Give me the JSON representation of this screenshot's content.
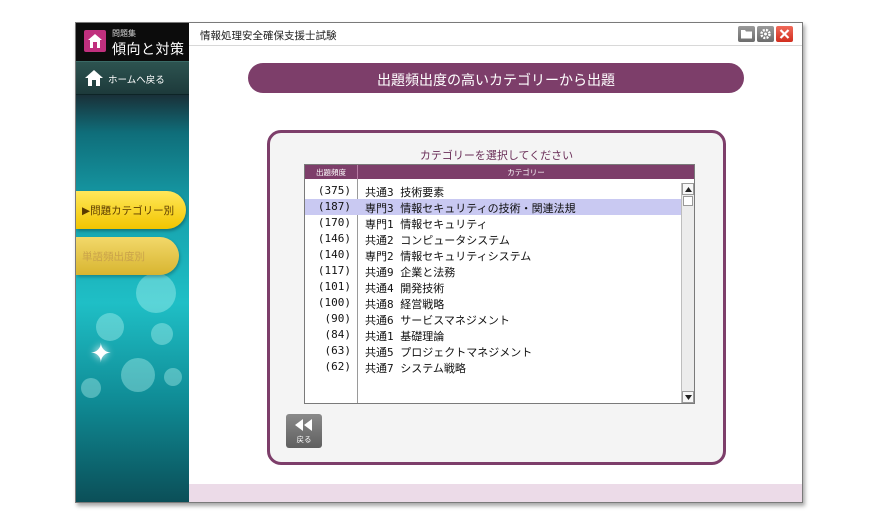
{
  "sidebar": {
    "logo": {
      "small": "問題集",
      "big": "傾向と対策"
    },
    "home_label": "ホームへ戻る",
    "tabs": [
      {
        "label": "▶問題カテゴリー別",
        "active": true
      },
      {
        "label": "単語頻出度別",
        "active": false
      }
    ]
  },
  "titlebar": {
    "title": "情報処理安全確保支援士試験",
    "buttons": [
      "folder-icon",
      "gear-icon",
      "close-icon"
    ]
  },
  "main": {
    "banner": "出題頻出度の高いカテゴリーから出題",
    "panel": {
      "heading": "カテゴリーを選択してください",
      "columns": {
        "count": "出題頻度",
        "category": "カテゴリー"
      },
      "rows": [
        {
          "count": "(375)",
          "category": "共通3 技術要素"
        },
        {
          "count": "(187)",
          "category": "専門3 情報セキュリティの技術・関連法規",
          "selected": true
        },
        {
          "count": "(170)",
          "category": "専門1 情報セキュリティ"
        },
        {
          "count": "(146)",
          "category": "共通2 コンピュータシステム"
        },
        {
          "count": "(140)",
          "category": "専門2 情報セキュリティシステム"
        },
        {
          "count": "(117)",
          "category": "共通9 企業と法務"
        },
        {
          "count": "(101)",
          "category": "共通4 開発技術"
        },
        {
          "count": "(100)",
          "category": "共通8 経営戦略"
        },
        {
          "count": "(90)",
          "category": "共通6 サービスマネジメント"
        },
        {
          "count": "(84)",
          "category": "共通1 基礎理論"
        },
        {
          "count": "(63)",
          "category": "共通5 プロジェクトマネジメント"
        },
        {
          "count": "(62)",
          "category": "共通7 システム戦略"
        }
      ]
    },
    "back_label": "戻る"
  },
  "colors": {
    "accent": "#7d3e6a",
    "selection": "#c9c9f2",
    "tab_yellow": "#f2c500",
    "close_red": "#d12e1e"
  }
}
